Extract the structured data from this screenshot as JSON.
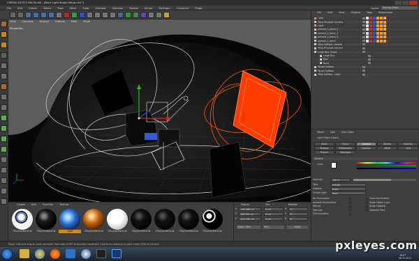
{
  "app": {
    "title": "CINEMA 4D R13.006 Studio - [Black Light Studio Setup.c4d *]",
    "menu": [
      "File",
      "Edit",
      "Create",
      "Select",
      "Tools",
      "Mesh",
      "Snap",
      "Animate",
      "Simulate",
      "Render",
      "Sculpt",
      "MoGraph",
      "Character",
      "Plugins",
      "Script",
      "Window",
      "Help"
    ],
    "layout_label": "Layout:",
    "layout_value": "Startup (User)"
  },
  "viewport": {
    "menu": [
      "View",
      "Cameras",
      "Display",
      "Options",
      "Filter",
      "Panel"
    ],
    "label": "Perspective"
  },
  "object_manager": {
    "menu": [
      "File",
      "Edit",
      "View",
      "Objects",
      "Tags",
      "Bookmarks"
    ],
    "rows": [
      {
        "name": "Light",
        "color": "#e0a030"
      },
      {
        "name": "VRay Physical Camera",
        "color": "#c8c8c8"
      },
      {
        "name": "Light",
        "color": "#e0a030"
      },
      {
        "name": "polmod_1_black_1",
        "color": "#c8c8c8"
      },
      {
        "name": "polmod_1_black_2",
        "color": "#c8c8c8"
      },
      {
        "name": "polmod_1_black_3",
        "color": "#c8c8c8"
      },
      {
        "name": "polmod_1_black",
        "color": "#c8c8c8"
      },
      {
        "name": "VRay Softbox Camera",
        "color": "#c8c8c8"
      },
      {
        "name": "VRay Physical Camera",
        "color": "#c8c8c8"
      },
      {
        "name": "Large Disc Studio",
        "color": "#c8c8c8"
      },
      {
        "name": "Large Disc",
        "color": "#c8c8c8"
      },
      {
        "name": "Disc",
        "color": "#c8c8c8"
      },
      {
        "name": "Band",
        "color": "#c8c8c8"
      },
      {
        "name": "Target Softbox",
        "color": "#c8c8c8"
      },
      {
        "name": "Target Softbox",
        "color": "#c8c8c8"
      },
      {
        "name": "VRay Softbox - Light",
        "color": "#c8c8c8"
      }
    ]
  },
  "attribute_manager": {
    "menu": [
      "Mode",
      "Edit",
      "User Data"
    ],
    "object_label": "Light Object [Light]",
    "tabs_row1": [
      "Basic",
      "Coord.",
      "General",
      "Details",
      "Visibility"
    ],
    "tabs_row2": [
      "Shadow",
      "Photometric",
      "Caustics",
      "Noise",
      "Lens"
    ],
    "tabs_row3": [
      "Project",
      "VRaylight"
    ],
    "active_tab": "General",
    "section": "General",
    "color_label": "Color",
    "intensity_label": "Intensity",
    "intensity_value": "100 %",
    "type_label": "Type",
    "type_value": "Infinite",
    "shadow_label": "Shadow",
    "shadow_value": "None",
    "visible_label": "Visible Light",
    "visible_value": "None",
    "checks_left": [
      "No Illumination",
      "Ambient Illumination",
      "Diffuse",
      "Specular",
      "GI Illumination"
    ],
    "checks_right": [
      "Show Illumination",
      "Show Visible Light",
      "Show Clipping",
      "Separate Pass"
    ]
  },
  "material_manager": {
    "menu": [
      "Create",
      "Edit",
      "Function",
      "Texture"
    ],
    "materials": [
      {
        "label": "VRayAdvMaterial",
        "style": "eye"
      },
      {
        "label": "VRayAdvMaterial",
        "style": "glossy-dark"
      },
      {
        "label": "Light",
        "style": "blue"
      },
      {
        "label": "VRayAdvMaterial",
        "style": "orange"
      },
      {
        "label": "VRayAdvMaterial",
        "style": "white"
      },
      {
        "label": "VRayAdvMaterial",
        "style": "black"
      },
      {
        "label": "VRayAdvMaterial",
        "style": "black"
      },
      {
        "label": "VRayAdvMaterial",
        "style": "black"
      },
      {
        "label": "VRayAdvMaterial",
        "style": "knot"
      }
    ],
    "selected_index": 2
  },
  "coordinates": {
    "headers": [
      "Position",
      "Size",
      "Rotation"
    ],
    "rows": [
      {
        "axis": "X",
        "pos": "-290.066 cm",
        "size": "0 cm",
        "rot_axis": "H",
        "rot": "0 °"
      },
      {
        "axis": "Y",
        "pos": "108.342 cm",
        "size": "0 cm",
        "rot_axis": "P",
        "rot": "0 °"
      },
      {
        "axis": "Z",
        "pos": "-811.791 cm",
        "size": "0 cm",
        "rot_axis": "B",
        "rot": "0 °"
      }
    ],
    "mode_value": "Object (Rel)",
    "size_mode_value": "Size",
    "apply_label": "Apply"
  },
  "status_bar": {
    "text": "Move: Click and drag to move elements. Hold down SHIFT to quantize movement / add to the selection in point mode, CTRL to remove."
  },
  "watermark": "pxleyes.com",
  "taskbar": {
    "date": "06.12.2012",
    "time": "18:07"
  },
  "colors": {
    "accent_orange": "#ff4a10",
    "selection": "#d08a1a",
    "gizmo_green": "#20c020",
    "gizmo_red": "#e02020",
    "gizmo_blue": "#2050ff"
  }
}
